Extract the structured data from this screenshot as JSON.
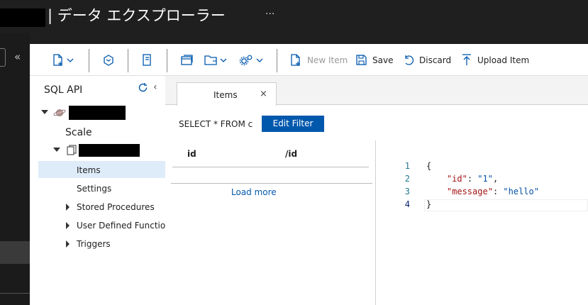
{
  "window": {
    "title": "| データ エクスプローラー",
    "more": "···"
  },
  "toolbar": {
    "new_item_label": "New Item",
    "save_label": "Save",
    "discard_label": "Discard",
    "upload_label": "Upload Item"
  },
  "sidebar": {
    "title": "SQL API",
    "collapse": "‹",
    "scale_label": "Scale",
    "items": [
      {
        "label": "Items",
        "selected": true
      },
      {
        "label": "Settings"
      },
      {
        "label": "Stored Procedures"
      },
      {
        "label": "User Defined Functions"
      },
      {
        "label": "Triggers"
      }
    ]
  },
  "tab": {
    "label": "Items",
    "close": "×"
  },
  "filter": {
    "query": "SELECT * FROM c",
    "edit_button": "Edit Filter"
  },
  "grid": {
    "columns": [
      "id",
      "/id"
    ],
    "load_more": "Load more"
  },
  "editor": {
    "line_numbers": [
      "1",
      "2",
      "3",
      "4"
    ],
    "open_brace": "{",
    "close_brace": "}",
    "key1": "\"id\"",
    "val1": "\"1\"",
    "key2": "\"message\"",
    "val2": "\"hello\"",
    "colon": ": ",
    "comma": ","
  },
  "colors": {
    "accent": "#0058ad",
    "selection": "#deecf9",
    "titlebar": "#1f1f1f"
  }
}
